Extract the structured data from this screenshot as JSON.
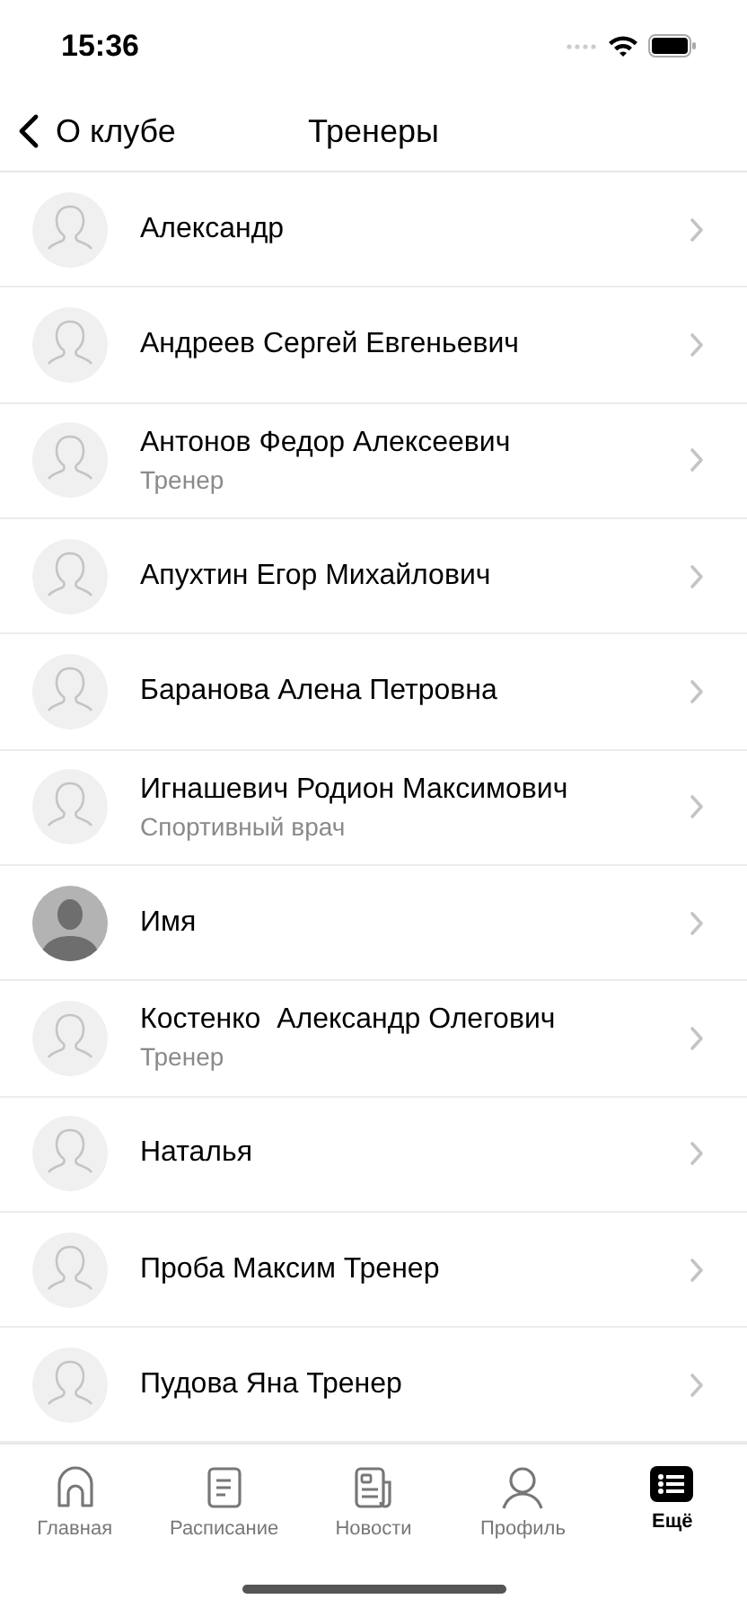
{
  "status_bar": {
    "time": "15:36"
  },
  "nav": {
    "back": "О клубе",
    "title": "Тренеры"
  },
  "people": [
    {
      "name": "Александр",
      "kind": "placeholder"
    },
    {
      "name": "Андреев Сергей Евгеньевич",
      "kind": "placeholder"
    },
    {
      "name": "Антонов Федор Алексеевич",
      "role": "Тренер",
      "kind": "placeholder"
    },
    {
      "name": "Апухтин Егор Михайлович",
      "kind": "placeholder"
    },
    {
      "name": "Баранова Алена Петровна",
      "kind": "placeholder"
    },
    {
      "name": "Игнашевич Родион Максимович",
      "role": "Спортивный врач",
      "kind": "placeholder"
    },
    {
      "name": "Имя",
      "kind": "photo"
    },
    {
      "name": "Костенко  Александр Олегович",
      "role": "Тренер",
      "kind": "placeholder"
    },
    {
      "name": "Наталья",
      "kind": "placeholder"
    },
    {
      "name": "Проба Максим Тренер",
      "kind": "placeholder"
    },
    {
      "name": "Пудова Яна Тренер",
      "kind": "placeholder"
    }
  ],
  "tabs": [
    {
      "label": "Главная",
      "selected": false
    },
    {
      "label": "Расписание",
      "selected": false
    },
    {
      "label": "Новости",
      "selected": false
    },
    {
      "label": "Профиль",
      "selected": false
    },
    {
      "label": "Ещё",
      "selected": true
    }
  ]
}
